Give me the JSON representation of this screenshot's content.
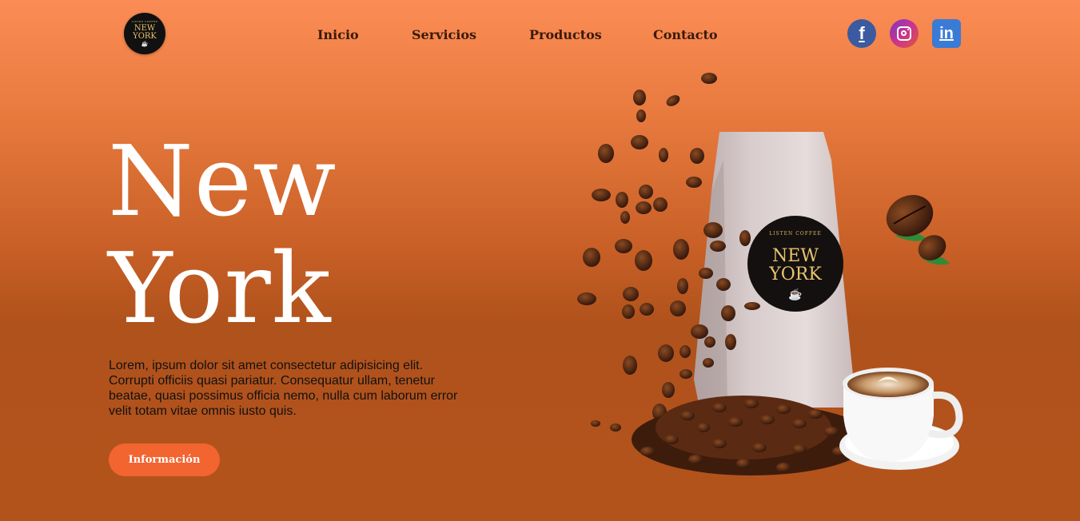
{
  "brand": {
    "logo_small_text": "LISTEN COFFEE",
    "logo_line1": "NEW",
    "logo_line2": "YORK"
  },
  "nav": {
    "items": [
      {
        "label": "Inicio"
      },
      {
        "label": "Servicios"
      },
      {
        "label": "Productos"
      },
      {
        "label": "Contacto"
      }
    ]
  },
  "social": {
    "facebook_glyph": "f",
    "linkedin_glyph": "in",
    "icons": [
      "facebook-icon",
      "instagram-icon",
      "linkedin-icon"
    ]
  },
  "hero": {
    "title_line1": "New",
    "title_line2": "York",
    "description": "Lorem, ipsum dolor sit amet consectetur adipisicing elit. Corrupti officiis quasi pariatur. Consequatur ullam, tenetur beatae, quasi possimus officia nemo, nulla cum laborum error velit totam vitae omnis iusto quis.",
    "button_label": "Información"
  },
  "product": {
    "label_small": "LISTEN COFFEE",
    "label_line1": "NEW",
    "label_line2": "YORK"
  },
  "colors": {
    "background_top": "#fb8c55",
    "background_bottom": "#b3531c",
    "accent_button": "#f26430",
    "nav_text": "#3a1a0a"
  }
}
